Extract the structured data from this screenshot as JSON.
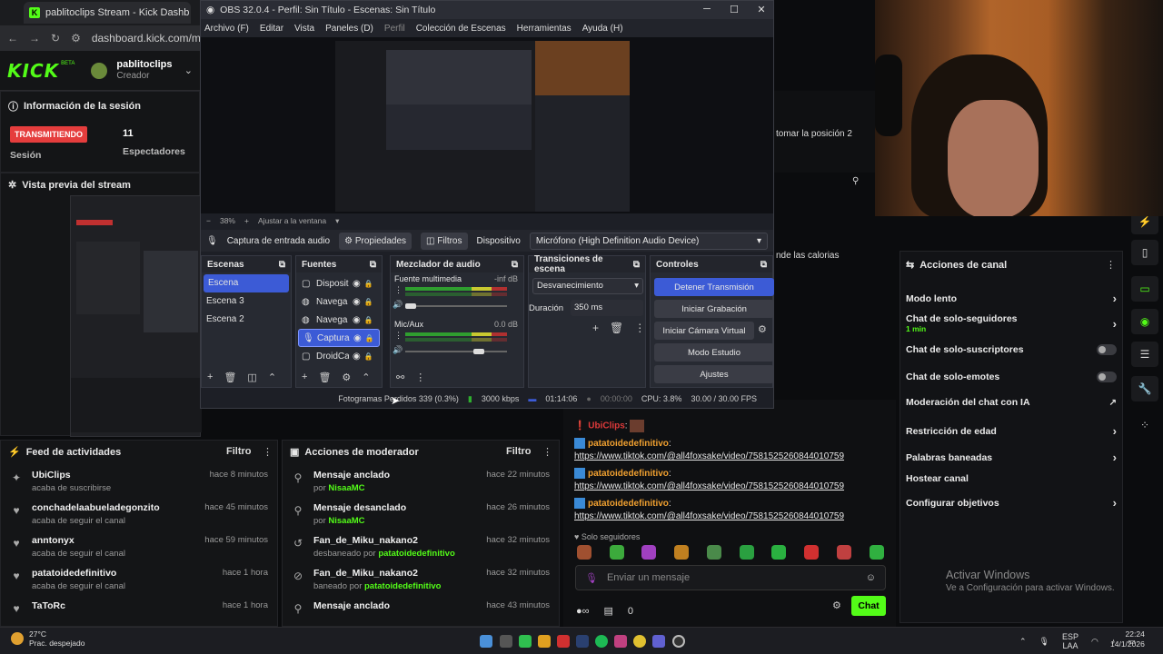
{
  "browser": {
    "tab_title": "pablitoclips Stream - Kick Dashb",
    "url": "dashboard.kick.com/moder"
  },
  "kick": {
    "logo": "KICK",
    "beta": "BETA",
    "user": "pablitoclips",
    "role": "Creador"
  },
  "session": {
    "title": "Información de la sesión",
    "live_badge": "TRANSMITIENDO",
    "viewers": "11",
    "viewers_label": "Espectadores",
    "session_label": "Sesión"
  },
  "preview": {
    "title": "Vista previa del stream"
  },
  "feed": {
    "title": "Feed de actividades",
    "filter": "Filtro",
    "items": [
      {
        "name": "UbiClips",
        "sub": "acaba de suscribirse",
        "time": "hace 8 minutos",
        "icon": "✦"
      },
      {
        "name": "conchadelaabueladegonzito",
        "sub": "acaba de seguir el canal",
        "time": "hace 45 minutos",
        "icon": "♥"
      },
      {
        "name": "anntonyx",
        "sub": "acaba de seguir el canal",
        "time": "hace 59 minutos",
        "icon": "♥"
      },
      {
        "name": "patatoidedefinitivo",
        "sub": "acaba de seguir el canal",
        "time": "hace 1 hora",
        "icon": "♥"
      },
      {
        "name": "TaToRc",
        "sub": "",
        "time": "hace 1 hora",
        "icon": "♥"
      }
    ]
  },
  "mod": {
    "title": "Acciones de moderador",
    "filter": "Filtro",
    "items": [
      {
        "title": "Mensaje anclado",
        "sub_prefix": "por ",
        "sub_user": "NisaaMC",
        "time": "hace 22 minutos",
        "icon": "⚲"
      },
      {
        "title": "Mensaje desanclado",
        "sub_prefix": "por ",
        "sub_user": "NisaaMC",
        "time": "hace 26 minutos",
        "icon": "⚲"
      },
      {
        "title": "Fan_de_Miku_nakano2",
        "sub_prefix": "desbaneado por ",
        "sub_user": "patatoidedefinitivo",
        "time": "hace 32 minutos",
        "icon": "↺"
      },
      {
        "title": "Fan_de_Miku_nakano2",
        "sub_prefix": "baneado por ",
        "sub_user": "patatoidedefinitivo",
        "time": "hace 32 minutos",
        "icon": "⊘"
      },
      {
        "title": "Mensaje anclado",
        "sub_prefix": "",
        "sub_user": "",
        "time": "hace 43 minutos",
        "icon": "⚲"
      }
    ]
  },
  "chat": {
    "pinned_user": "UbiClips",
    "messages": [
      {
        "user": "patatoidedefinitivo",
        "link": "https://www.tiktok.com/@all4foxsake/video/7581525260844010759"
      },
      {
        "user": "patatoidedefinitivo",
        "link": "https://www.tiktok.com/@all4foxsake/video/7581525260844010759"
      },
      {
        "user": "patatoidedefinitivo",
        "link": "https://www.tiktok.com/@all4foxsake/video/7581525260844010759"
      }
    ],
    "followers_only": "Solo seguidores",
    "input_placeholder": "Enviar un mensaje",
    "send": "Chat",
    "count": "0"
  },
  "right_top": {
    "text1": "tomar la posición 2",
    "text2": "nde las calorias"
  },
  "actions": {
    "title": "Acciones de canal",
    "rows": [
      {
        "label": "Modo lento",
        "sub": "",
        "type": "chevron"
      },
      {
        "label": "Chat de solo-seguidores",
        "sub": "1 min",
        "type": "chevron"
      },
      {
        "label": "Chat de solo-suscriptores",
        "sub": "",
        "type": "toggle"
      },
      {
        "label": "Chat de solo-emotes",
        "sub": "",
        "type": "toggle"
      },
      {
        "label": "Moderación del chat con IA",
        "sub": "",
        "type": "external"
      },
      {
        "label": "Restricción de edad",
        "sub": "",
        "type": "chevron"
      },
      {
        "label": "Palabras baneadas",
        "sub": "",
        "type": "chevron"
      },
      {
        "label": "Hostear canal",
        "sub": "",
        "type": "none"
      },
      {
        "label": "Configurar objetivos",
        "sub": "",
        "type": "chevron"
      }
    ]
  },
  "windows": {
    "activate_title": "Activar Windows",
    "activate_sub": "Ve a Configuración para activar Windows.",
    "temp": "27°C",
    "weather": "Prac. despejado",
    "lang1": "ESP",
    "lang2": "LAA",
    "time": "22:24",
    "date": "14/1/2026"
  },
  "obs": {
    "title": "OBS 32.0.4 - Perfil: Sin Título - Escenas: Sin Título",
    "menu": [
      "Archivo (F)",
      "Editar",
      "Vista",
      "Paneles (D)",
      "Perfil",
      "Colección de Escenas",
      "Herramientas",
      "Ayuda (H)"
    ],
    "zoom": "38%",
    "zoom_mode": "Ajustar a la ventana",
    "source_label": "Captura de entrada audio",
    "props": "Propiedades",
    "filters": "Filtros",
    "device_label": "Dispositivo",
    "device": "Micrófono (High Definition Audio Device)",
    "docks": {
      "scenes": "Escenas",
      "sources": "Fuentes",
      "mixer": "Mezclador de audio",
      "transitions": "Transiciones de escena",
      "controls": "Controles"
    },
    "scenes": [
      "Escena",
      "Escena 3",
      "Escena 2"
    ],
    "sources": [
      "Disposit",
      "Navega",
      "Navega",
      "Captura",
      "DroidCa"
    ],
    "mixer": [
      {
        "name": "Fuente multimedia",
        "db": "-inf dB",
        "level": 0.0
      },
      {
        "name": "Mic/Aux",
        "db": "0.0 dB",
        "level": 0.75
      }
    ],
    "transition": "Desvanecimiento",
    "duration_label": "Duración",
    "duration": "350 ms",
    "controls": [
      "Detener Transmisión",
      "Iniciar Grabación",
      "Iniciar Cámara Virtual",
      "Modo Estudio",
      "Ajustes"
    ],
    "status": {
      "dropped": "Fotogramas Perdidos 339 (0.3%)",
      "kbps": "3000 kbps",
      "stream_time": "01:14:06",
      "rec_time": "00:00:00",
      "cpu": "CPU: 3.8%",
      "fps": "30.00 / 30.00 FPS"
    }
  },
  "colors": {
    "accent": "#53fc18",
    "obs_select": "#3c5bd6",
    "live": "#e53d3d"
  }
}
